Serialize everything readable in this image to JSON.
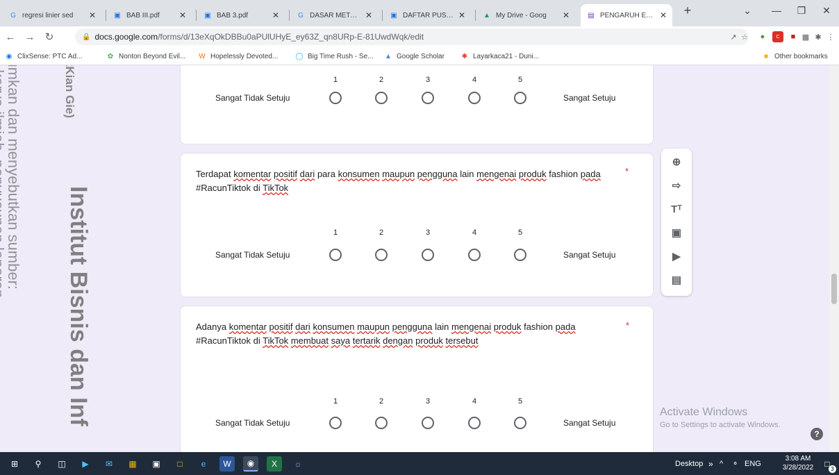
{
  "browser": {
    "tabs": [
      {
        "label": "regresi linier sed",
        "icon": "google-icon",
        "active": false
      },
      {
        "label": "BAB III.pdf",
        "icon": "docs-icon",
        "active": false
      },
      {
        "label": "BAB 3.pdf",
        "icon": "docs-icon",
        "active": false
      },
      {
        "label": "DASAR METODO",
        "icon": "google-icon",
        "active": false
      },
      {
        "label": "DAFTAR PUSTAK",
        "icon": "docs-icon",
        "active": false
      },
      {
        "label": "My Drive - Goog",
        "icon": "drive-icon",
        "active": false
      },
      {
        "label": "PENGARUH ELEC",
        "icon": "forms-icon",
        "active": true
      }
    ],
    "url_host": "docs.google.com",
    "url_path": "/forms/d/13eXqOkDBBu0aPUlUHyE_ey63Z_qn8URp-E-81UwdWqk/edit",
    "bookmarks": [
      {
        "label": "ClixSense: PTC Ad...",
        "icon": "clixsense-icon"
      },
      {
        "label": "Nonton Beyond Evil...",
        "icon": "film-icon"
      },
      {
        "label": "Hopelessly Devoted...",
        "icon": "wattpad-icon"
      },
      {
        "label": "Big Time Rush - Se...",
        "icon": "big-time-rush-icon"
      },
      {
        "label": "Google Scholar",
        "icon": "scholar-icon"
      },
      {
        "label": "Layarkaca21 - Duni...",
        "icon": "layarkaca-icon"
      }
    ],
    "other_bookmarks": "Other bookmarks"
  },
  "form": {
    "scale_numbers": [
      "1",
      "2",
      "3",
      "4",
      "5"
    ],
    "low_label": "Sangat Tidak Setuju",
    "high_label": "Sangat Setuju",
    "required_mark": "*",
    "q2": {
      "segments": [
        {
          "t": "Terdapat",
          "sq": false
        },
        {
          "t": " ",
          "sq": false
        },
        {
          "t": "komentar",
          "sq": true
        },
        {
          "t": " ",
          "sq": false
        },
        {
          "t": "positif",
          "sq": true
        },
        {
          "t": " ",
          "sq": false
        },
        {
          "t": "dari",
          "sq": true
        },
        {
          "t": " para ",
          "sq": false
        },
        {
          "t": "konsumen",
          "sq": true
        },
        {
          "t": " ",
          "sq": false
        },
        {
          "t": "maupun",
          "sq": true
        },
        {
          "t": " ",
          "sq": false
        },
        {
          "t": "pengguna",
          "sq": true
        },
        {
          "t": " lain ",
          "sq": false
        },
        {
          "t": "mengenai",
          "sq": true
        },
        {
          "t": " ",
          "sq": false
        },
        {
          "t": "produk",
          "sq": true
        },
        {
          "t": " fashion ",
          "sq": false
        },
        {
          "t": "pada",
          "sq": true
        },
        {
          "t": " #RacunTiktok di ",
          "sq": false
        },
        {
          "t": "TikTok",
          "sq": true
        }
      ]
    },
    "q3": {
      "segments": [
        {
          "t": "Adanya",
          "sq": false
        },
        {
          "t": " ",
          "sq": false
        },
        {
          "t": "komentar",
          "sq": true
        },
        {
          "t": " ",
          "sq": false
        },
        {
          "t": "positif",
          "sq": true
        },
        {
          "t": " ",
          "sq": false
        },
        {
          "t": "dari",
          "sq": true
        },
        {
          "t": " ",
          "sq": false
        },
        {
          "t": "konsumen",
          "sq": true
        },
        {
          "t": " ",
          "sq": false
        },
        {
          "t": "maupun",
          "sq": true
        },
        {
          "t": " ",
          "sq": false
        },
        {
          "t": "pengguna",
          "sq": true
        },
        {
          "t": " lain ",
          "sq": false
        },
        {
          "t": "mengenai",
          "sq": true
        },
        {
          "t": " ",
          "sq": false
        },
        {
          "t": "produk",
          "sq": true
        },
        {
          "t": " fashion ",
          "sq": false
        },
        {
          "t": "pada",
          "sq": true
        },
        {
          "t": " #RacunTiktok di ",
          "sq": false
        },
        {
          "t": "TikTok",
          "sq": true
        },
        {
          "t": " ",
          "sq": false
        },
        {
          "t": "membuat",
          "sq": true
        },
        {
          "t": " ",
          "sq": false
        },
        {
          "t": "saya",
          "sq": true
        },
        {
          "t": " ",
          "sq": false
        },
        {
          "t": "tertarik",
          "sq": true
        },
        {
          "t": " ",
          "sq": false
        },
        {
          "t": "dengan",
          "sq": true
        },
        {
          "t": " ",
          "sq": false
        },
        {
          "t": "produk",
          "sq": true
        },
        {
          "t": " ",
          "sq": false
        },
        {
          "t": "tersebut",
          "sq": true
        }
      ]
    }
  },
  "side_toolbar": [
    "add-question-icon",
    "import-questions-icon",
    "add-title-icon",
    "add-image-icon",
    "add-video-icon",
    "add-section-icon"
  ],
  "windows_notice": {
    "line1": "Activate Windows",
    "line2": "Go to Settings to activate Windows."
  },
  "watermark": {
    "big": "Institut Bisnis dan Inf",
    "top": "wikKian Gie)",
    "thin1": "mencantumkan dan menyebutkan sumber:",
    "thin2": "penulisan karya ilmiah, penyusunan laporan"
  },
  "taskbar": {
    "desktop_label": "Desktop",
    "chevron": "»",
    "lang": "ENG",
    "time": "3:08 AM",
    "date": "3/28/2022",
    "notif_count": "3"
  }
}
